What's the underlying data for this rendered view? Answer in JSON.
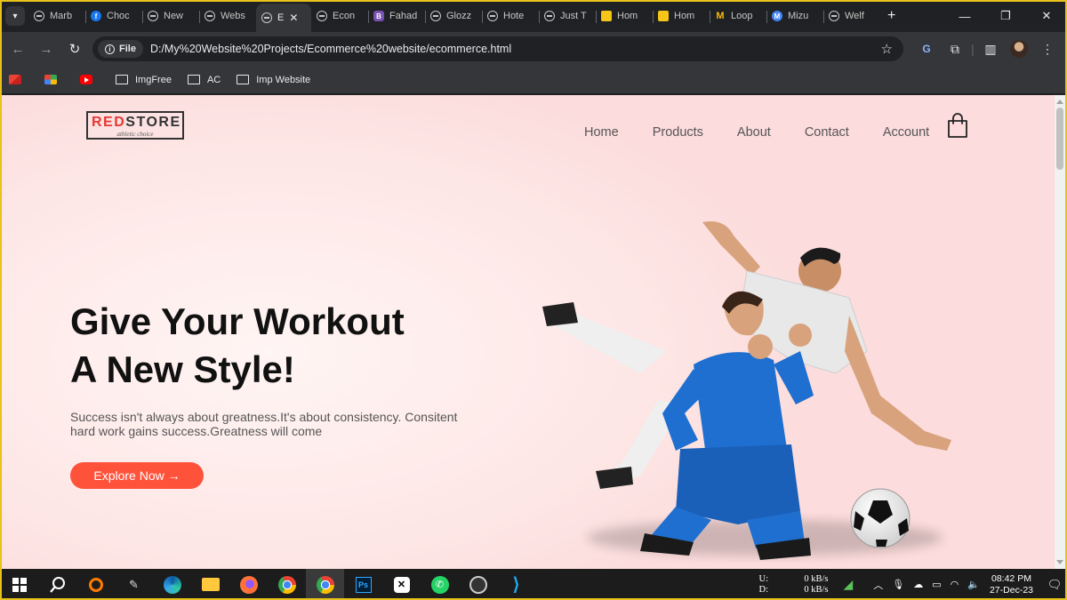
{
  "browser": {
    "tabs": [
      {
        "label": "Marb",
        "icon": "globe-icon"
      },
      {
        "label": "Choc",
        "icon": "facebook-icon"
      },
      {
        "label": "New",
        "icon": "globe-icon"
      },
      {
        "label": "Webs",
        "icon": "globe-icon"
      },
      {
        "label": "E",
        "icon": "globe-icon",
        "active": true
      },
      {
        "label": "Econ",
        "icon": "globe-icon"
      },
      {
        "label": "Fahad",
        "icon": "bootstrap-icon"
      },
      {
        "label": "Glozz",
        "icon": "globe-icon"
      },
      {
        "label": "Hote",
        "icon": "globe-icon"
      },
      {
        "label": "Just T",
        "icon": "globe-icon"
      },
      {
        "label": "Hom",
        "icon": "yellow-logo-icon"
      },
      {
        "label": "Hom",
        "icon": "yellow-logo-icon"
      },
      {
        "label": "Loop",
        "icon": "m-logo-icon"
      },
      {
        "label": "Mizu",
        "icon": "mizu-icon"
      },
      {
        "label": "Welf",
        "icon": "globe-icon"
      }
    ],
    "chip_label": "File",
    "url": "D:/My%20Website%20Projects/Ecommerce%20website/ecommerce.html",
    "bookmarks": [
      "ImgFree",
      "AC",
      "Imp Website"
    ]
  },
  "page": {
    "logo_red": "RED",
    "logo_dark": "STORE",
    "logo_tagline": "athletic choice",
    "nav": [
      "Home",
      "Products",
      "About",
      "Contact",
      "Account"
    ],
    "hero_title_line1": "Give Your Workout",
    "hero_title_line2": "A New Style!",
    "hero_subtitle_line1": "Success isn't always about greatness.It's about consistency. Consitent",
    "hero_subtitle_line2": "hard work gains success.Greatness will come",
    "cta_label": "Explore Now →",
    "accent_color": "#ff523b"
  },
  "taskbar": {
    "net_up_label": "U:",
    "net_up_value": "0 kB/s",
    "net_down_label": "D:",
    "net_down_value": "0 kB/s",
    "time": "08:42 PM",
    "date": "27-Dec-23"
  }
}
